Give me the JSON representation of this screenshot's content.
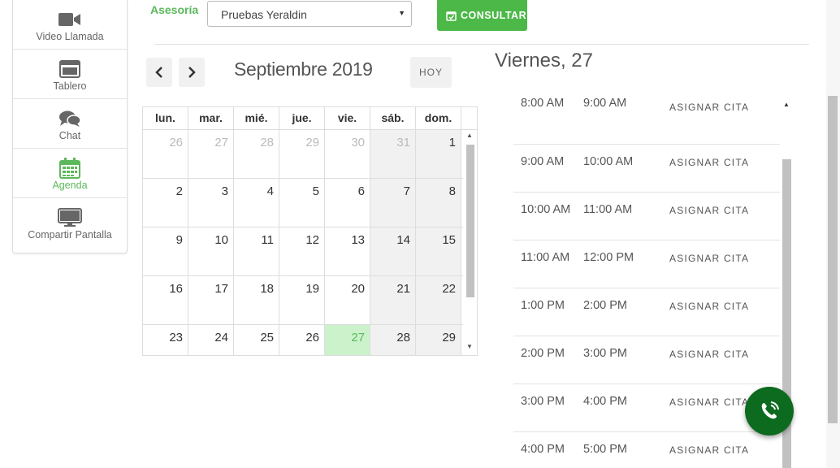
{
  "sidebar": {
    "items": [
      {
        "label": "Video Llamada",
        "icon": "video-camera-icon"
      },
      {
        "label": "Tablero",
        "icon": "monitor-window-icon"
      },
      {
        "label": "Chat",
        "icon": "chat-bubbles-icon"
      },
      {
        "label": "Agenda",
        "icon": "calendar-icon",
        "active": true
      },
      {
        "label": "Compartir Pantalla",
        "icon": "desktop-icon"
      }
    ]
  },
  "toolbar": {
    "asesoria_label": "Asesoría",
    "asesor_selected": "Pruebas Yeraldin",
    "consultar_label": "CONSULTAR C"
  },
  "calendar": {
    "month_title": "Septiembre 2019",
    "today_label": "HOY",
    "weekdays": [
      "lun.",
      "mar.",
      "mié.",
      "jue.",
      "vie.",
      "sáb.",
      "dom."
    ],
    "weeks": [
      [
        "26",
        "27",
        "28",
        "29",
        "30",
        "31",
        "1"
      ],
      [
        "2",
        "3",
        "4",
        "5",
        "6",
        "7",
        "8"
      ],
      [
        "9",
        "10",
        "11",
        "12",
        "13",
        "14",
        "15"
      ],
      [
        "16",
        "17",
        "18",
        "19",
        "20",
        "21",
        "22"
      ],
      [
        "23",
        "24",
        "25",
        "26",
        "27",
        "28",
        "29"
      ]
    ],
    "today_cell": "27"
  },
  "day": {
    "title": "Viernes, 27",
    "slots": [
      {
        "start": "8:00 AM",
        "end": "9:00 AM",
        "action": "ASIGNAR CITA"
      },
      {
        "start": "9:00 AM",
        "end": "10:00 AM",
        "action": "ASIGNAR CITA"
      },
      {
        "start": "10:00 AM",
        "end": "11:00 AM",
        "action": "ASIGNAR CITA"
      },
      {
        "start": "11:00 AM",
        "end": "12:00 PM",
        "action": "ASIGNAR CITA"
      },
      {
        "start": "1:00 PM",
        "end": "2:00 PM",
        "action": "ASIGNAR CITA"
      },
      {
        "start": "2:00 PM",
        "end": "3:00 PM",
        "action": "ASIGNAR CITA"
      },
      {
        "start": "3:00 PM",
        "end": "4:00 PM",
        "action": "ASIGNAR CITA"
      },
      {
        "start": "4:00 PM",
        "end": "5:00 PM",
        "action": "ASIGNAR CITA"
      }
    ]
  },
  "colors": {
    "accent_green": "#5cb85c",
    "button_green": "#4cb848",
    "today_bg": "#ccf2cc",
    "fab_green": "#0c6b1e"
  }
}
